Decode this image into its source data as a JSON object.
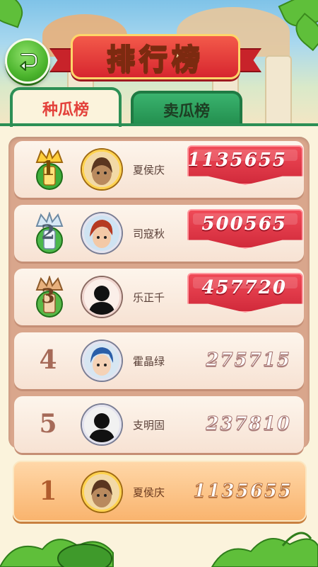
{
  "title": "排行榜",
  "tabs": [
    {
      "label": "种瓜榜",
      "active": true
    },
    {
      "label": "卖瓜榜",
      "active": false
    }
  ],
  "leaderboard": [
    {
      "rank": "1",
      "name": "夏侯庆",
      "score": "1135655",
      "medal": "gold-crown"
    },
    {
      "rank": "2",
      "name": "司寇秋",
      "score": "500565",
      "medal": "silver-crown"
    },
    {
      "rank": "3",
      "name": "乐正千",
      "score": "457720",
      "medal": "bronze-crown"
    },
    {
      "rank": "4",
      "name": "霍晶绿",
      "score": "275715"
    },
    {
      "rank": "5",
      "name": "支明固",
      "score": "237810"
    }
  ],
  "my_rank": {
    "rank": "1",
    "name": "夏侯庆",
    "score": "1135655"
  },
  "colors": {
    "accent_green": "#2c8f55",
    "ribbon_red": "#d7262f",
    "active_tab_text": "#e3413b"
  },
  "icons": {
    "back": "back-arrow-icon"
  }
}
